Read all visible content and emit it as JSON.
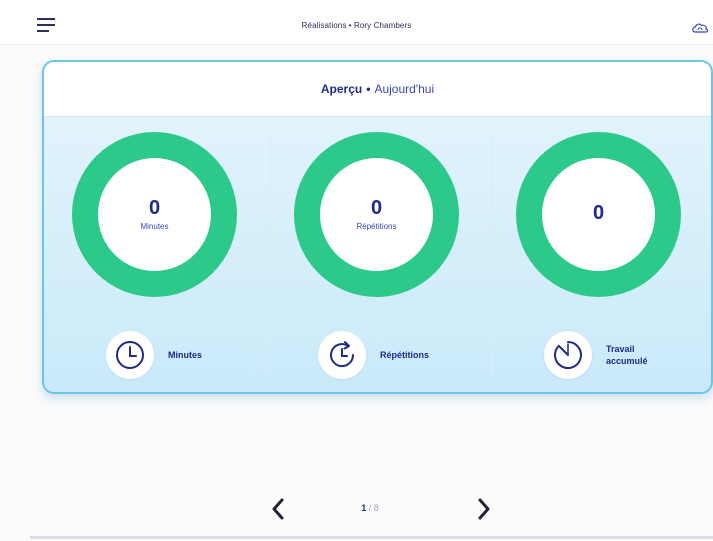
{
  "topbar": {
    "title": "Réalisations • Rory Chambers",
    "menu_icon": "hamburger-menu-icon",
    "cloud_icon": "cloud-sync-icon"
  },
  "card": {
    "title": "Aperçu",
    "separator": "•",
    "period": "Aujourd'hui"
  },
  "metrics": [
    {
      "value": "0",
      "unit": "Minutes",
      "label_line1": "Minutes",
      "label_line2": "",
      "icon": "clock-icon"
    },
    {
      "value": "0",
      "unit": "Répétitions",
      "label_line1": "Répétitions",
      "label_line2": "",
      "icon": "repeat-icon"
    },
    {
      "value": "0",
      "unit": "",
      "label_line1": "Travail",
      "label_line2": "accumulé",
      "icon": "accumulated-work-icon"
    }
  ],
  "pager": {
    "current": "1",
    "separator": " / ",
    "total": "8"
  },
  "colors": {
    "ring": "#2dc98a",
    "accent": "#1f2a8a",
    "card_border": "#6ec6e6",
    "card_bg": "#c9eafa"
  }
}
